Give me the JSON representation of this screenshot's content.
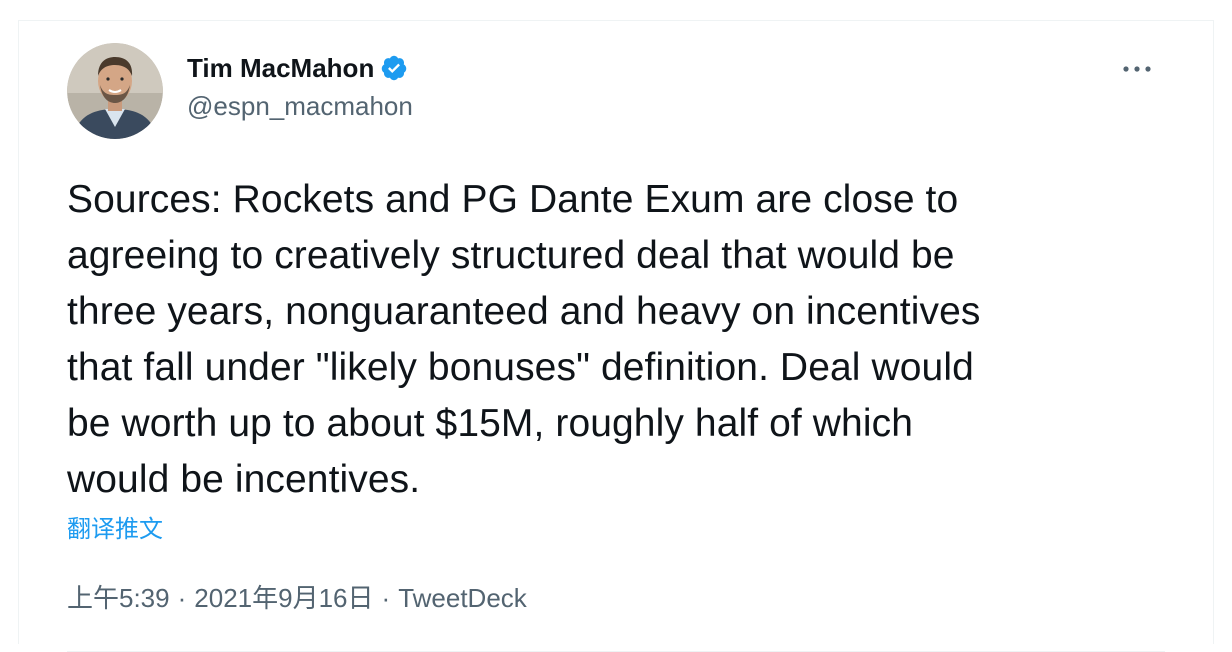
{
  "author": {
    "display_name": "Tim MacMahon",
    "handle": "@espn_macmahon",
    "verified": true,
    "avatar_icon": "person-avatar",
    "badge_color": "#1d9bf0"
  },
  "tweet": {
    "text": "Sources: Rockets and PG Dante Exum are close to\nagreeing to creatively structured deal that would be\nthree years, nonguaranteed and heavy on incentives\nthat fall under \"likely bonuses\" definition. Deal would\nbe worth up to about $15M, roughly half of which\nwould be incentives.",
    "translate_label": "翻译推文"
  },
  "meta": {
    "time": "上午5:39",
    "separator": "·",
    "date": "2021年9月16日",
    "source": "TweetDeck"
  },
  "menu": {
    "more_icon": "more-horizontal-icon"
  },
  "colors": {
    "text": "#0f1419",
    "secondary": "#536471",
    "link": "#1d9bf0",
    "border": "#eff3f4"
  }
}
